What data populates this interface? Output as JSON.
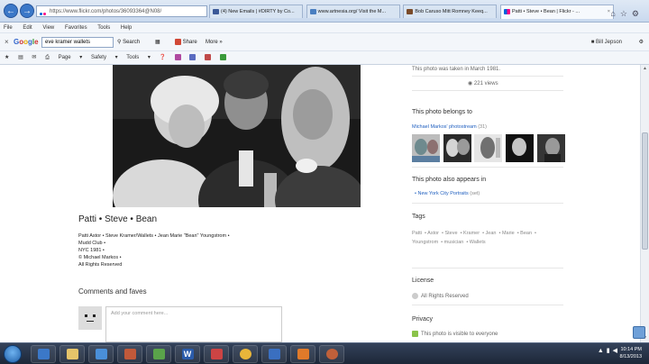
{
  "browser": {
    "address": "https://www.flickr.com/photos/36093364@N08/",
    "tabs": [
      {
        "label": "Patti • Steve • Bean | Flickr - ...",
        "active": true
      },
      {
        "label": "(4) New Emails | #DIRTY by Co...",
        "active": false
      },
      {
        "label": "www.artnesia.org/ Visit the M...",
        "active": false
      },
      {
        "label": "Bob Caruso Mitt Romney Keeq...",
        "active": false
      }
    ],
    "menu": [
      "File",
      "Edit",
      "View",
      "Favorites",
      "Tools",
      "Help"
    ],
    "google_label": "Google",
    "search_value": "eve kramer wallets",
    "toolbar": {
      "search_label": "Search",
      "share_label": "Share",
      "more_label": "More »",
      "user_label": "Bill Jepson"
    },
    "command": {
      "page_label": "Page",
      "safety_label": "Safety",
      "tools_label": "Tools"
    }
  },
  "photo": {
    "title": "Patti • Steve • Bean",
    "description": [
      "Patti Astor • Steve Kramer/Wallets • Jean Marie \"Bean\" Youngstrom •",
      "Mudd Club •",
      "NYC 1981 •",
      "© Michael Markos •",
      "All Rights Reserved"
    ]
  },
  "comments": {
    "heading": "Comments and faves",
    "placeholder": "Add your comment here..."
  },
  "sidebar": {
    "taken": "This photo was taken in March 1981.",
    "views": "221 views",
    "belongs_heading": "This photo belongs to",
    "photostream_link": "Michael Markos' photostream",
    "photostream_count": "(31)",
    "appears_heading": "This photo also appears in",
    "set_link": "New York City Portraits",
    "set_suffix": "(set)",
    "tags_heading": "Tags",
    "tags": [
      "Patti",
      "Astor",
      "Steve",
      "Kramer",
      "Jean",
      "Marie",
      "Bean",
      "Youngstrom",
      "musician",
      "Wallets"
    ],
    "license_heading": "License",
    "license_value": "All Rights Reserved",
    "privacy_heading": "Privacy",
    "privacy_value": "This photo is visible to everyone"
  },
  "taskbar": {
    "time": "10:14 PM",
    "date": "8/13/2013"
  },
  "colors": {
    "flickr_blue": "#0063dc",
    "flickr_pink": "#ff0084",
    "link": "#1f5fbf",
    "taskbar": "#1d2738"
  }
}
